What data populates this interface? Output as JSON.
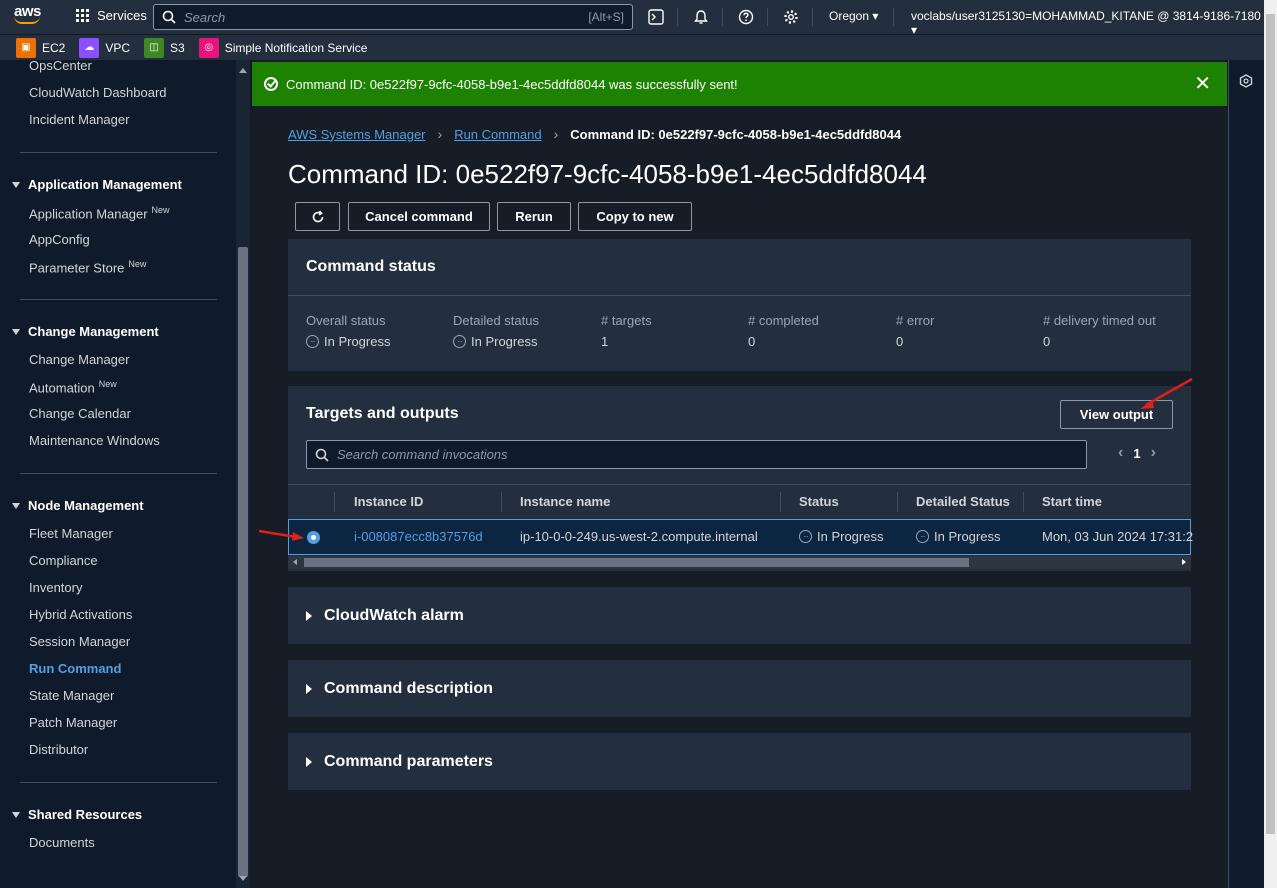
{
  "topnav": {
    "logo_text": "aws",
    "services_label": "Services",
    "search_placeholder": "Search",
    "search_hint": "[Alt+S]",
    "region": "Oregon ▾",
    "account": "voclabs/user3125130=MOHAMMAD_KITANE @ 3814-9186-7180 ▾"
  },
  "favorites": [
    {
      "label": "EC2",
      "color": "#ed7100",
      "icon": "ec2-icon"
    },
    {
      "label": "VPC",
      "color": "#8c4fff",
      "icon": "vpc-icon"
    },
    {
      "label": "S3",
      "color": "#3f8624",
      "icon": "s3-icon"
    },
    {
      "label": "Simple Notification Service",
      "color": "#e7157b",
      "icon": "sns-icon"
    }
  ],
  "sidebar": {
    "items_top": [
      "OpsCenter",
      "CloudWatch Dashboard",
      "Incident Manager"
    ],
    "app_mgmt": {
      "title": "Application Management",
      "items": [
        "Application Manager",
        "AppConfig",
        "Parameter Store"
      ]
    },
    "change_mgmt": {
      "title": "Change Management",
      "items": [
        "Change Manager",
        "Automation",
        "Change Calendar",
        "Maintenance Windows"
      ]
    },
    "node_mgmt": {
      "title": "Node Management",
      "items": [
        "Fleet Manager",
        "Compliance",
        "Inventory",
        "Hybrid Activations",
        "Session Manager",
        "Run Command",
        "State Manager",
        "Patch Manager",
        "Distributor"
      ]
    },
    "shared": {
      "title": "Shared Resources",
      "items": [
        "Documents"
      ]
    },
    "new_tag": "New"
  },
  "flash": {
    "message": "Command ID: 0e522f97-9cfc-4058-b9e1-4ec5ddfd8044  was successfully sent!",
    "color": "#1d8102"
  },
  "breadcrumb": {
    "root": "AWS Systems Manager",
    "parent": "Run Command",
    "current": "Command ID: 0e522f97-9cfc-4058-b9e1-4ec5ddfd8044"
  },
  "page_title": "Command ID: 0e522f97-9cfc-4058-b9e1-4ec5ddfd8044",
  "toolbar": {
    "cancel": "Cancel command",
    "rerun": "Rerun",
    "copy": "Copy to new"
  },
  "command_status": {
    "title": "Command status",
    "stats": [
      {
        "label": "Overall status",
        "value": "In Progress",
        "icon": true
      },
      {
        "label": "Detailed status",
        "value": "In Progress",
        "icon": true
      },
      {
        "label": "# targets",
        "value": "1"
      },
      {
        "label": "# completed",
        "value": "0"
      },
      {
        "label": "# error",
        "value": "0"
      },
      {
        "label": "# delivery timed out",
        "value": "0"
      }
    ]
  },
  "targets": {
    "title": "Targets and outputs",
    "view_output": "View output",
    "search_placeholder": "Search command invocations",
    "page": "1",
    "columns": [
      "Instance ID",
      "Instance name",
      "Status",
      "Detailed Status",
      "Start time"
    ],
    "row": {
      "instance_id": "i-008087ecc8b37576d",
      "instance_name": "ip-10-0-0-249.us-west-2.compute.internal",
      "status": "In Progress",
      "detailed_status": "In Progress",
      "start_time": "Mon, 03 Jun 2024 17:31:2"
    }
  },
  "sections": [
    "CloudWatch alarm",
    "Command description",
    "Command parameters"
  ],
  "accent_color": "#539fe5"
}
